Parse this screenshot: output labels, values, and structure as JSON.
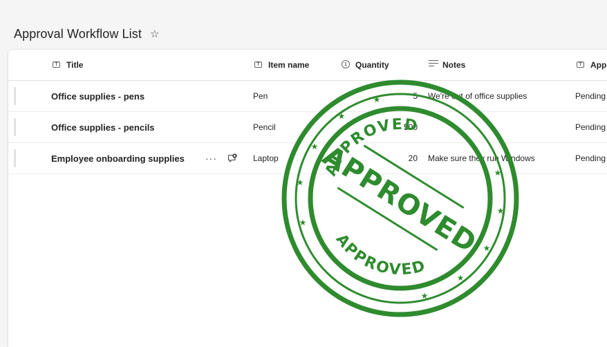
{
  "page": {
    "title": "Approval Workflow List"
  },
  "columns": {
    "title": "Title",
    "item_name": "Item name",
    "quantity": "Quantity",
    "notes": "Notes",
    "approval": "Appr"
  },
  "rows": [
    {
      "title": "Office supplies - pens",
      "item_name": "Pen",
      "quantity": "5",
      "notes": "We're out of office supplies",
      "status": "Pending"
    },
    {
      "title": "Office supplies - pencils",
      "item_name": "Pencil",
      "quantity": "500",
      "notes": "",
      "status": "Pending"
    },
    {
      "title": "Employee onboarding supplies",
      "item_name": "Laptop",
      "quantity": "20",
      "notes": "Make sure they run Windows",
      "status": "Pending"
    }
  ],
  "row_actions": {
    "more_label": "···"
  },
  "stamp": {
    "text": "APPROVED",
    "color": "#2e8b2e"
  },
  "icons": {
    "favorite": "star-outline-icon",
    "text_column": "text-field-icon",
    "number_column": "number-field-icon",
    "notes_column": "multiline-text-icon",
    "more": "more-horizontal-icon",
    "comment": "comment-add-icon"
  }
}
